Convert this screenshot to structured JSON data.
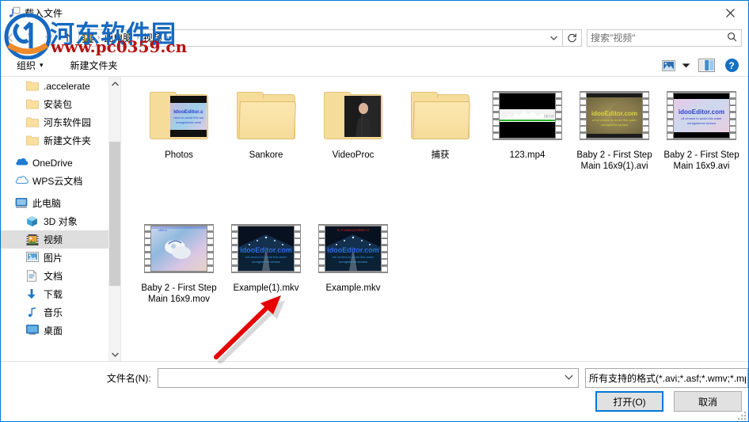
{
  "window": {
    "title": "载入文件",
    "title_icon": "music-file-icon",
    "close_label": "✕"
  },
  "nav_toolbar": {
    "back_icon": "back-arrow-icon",
    "forward_icon": "forward-arrow-icon",
    "recent_icon": "chevron-down-icon",
    "up_icon": "up-arrow-icon",
    "refresh_icon": "refresh-icon",
    "address_dropdown_icon": "chevron-down-icon",
    "breadcrumb_icon": "video-folder-icon",
    "breadcrumbs": [
      {
        "label": "此电脑"
      },
      {
        "label": "视频"
      }
    ],
    "separator": "›"
  },
  "search": {
    "placeholder": "搜索\"视频\"",
    "icon": "search-icon"
  },
  "command_bar": {
    "organize_label": "组织",
    "organize_caret": "▾",
    "new_folder_label": "新建文件夹",
    "view_icon": "view-layout-icon",
    "view_caret": "▾",
    "preview_pane_icon": "preview-pane-icon",
    "help_icon": "help-icon",
    "help_glyph": "?"
  },
  "nav_pane": {
    "items": [
      {
        "label": ".accelerate",
        "icon": "folder-icon",
        "level": 1,
        "selected": false
      },
      {
        "label": "安装包",
        "icon": "folder-icon",
        "level": 1,
        "selected": false
      },
      {
        "label": "河东软件园",
        "icon": "folder-icon",
        "level": 1,
        "selected": false
      },
      {
        "label": "新建文件夹",
        "icon": "folder-icon",
        "level": 1,
        "selected": false
      },
      {
        "label": "OneDrive",
        "icon": "onedrive-icon",
        "level": 0,
        "selected": false
      },
      {
        "label": "WPS云文档",
        "icon": "wps-cloud-icon",
        "level": 0,
        "selected": false
      },
      {
        "label": "此电脑",
        "icon": "this-pc-icon",
        "level": 0,
        "selected": false
      },
      {
        "label": "3D 对象",
        "icon": "3d-objects-icon",
        "level": 2,
        "selected": false
      },
      {
        "label": "视频",
        "icon": "videos-icon",
        "level": 2,
        "selected": true
      },
      {
        "label": "图片",
        "icon": "pictures-icon",
        "level": 2,
        "selected": false
      },
      {
        "label": "文档",
        "icon": "documents-icon",
        "level": 2,
        "selected": false
      },
      {
        "label": "下载",
        "icon": "downloads-icon",
        "level": 2,
        "selected": false
      },
      {
        "label": "音乐",
        "icon": "music-icon",
        "level": 2,
        "selected": false
      },
      {
        "label": "桌面",
        "icon": "desktop-icon",
        "level": 2,
        "selected": false
      }
    ],
    "scroll_up_glyph": "⌃",
    "scroll_down_glyph": "⌄"
  },
  "files": [
    {
      "name": "Photos",
      "type": "folder",
      "thumb": "photos-preview"
    },
    {
      "name": "Sankore",
      "type": "folder",
      "thumb": "none"
    },
    {
      "name": "VideoProc",
      "type": "folder",
      "thumb": "videoproc-preview"
    },
    {
      "name": "捕获",
      "type": "folder",
      "thumb": "none"
    },
    {
      "name": "123.mp4",
      "type": "video",
      "thumb": "waveform-dark"
    },
    {
      "name": "Baby 2 - First Step Main 16x9(1).avi",
      "type": "video",
      "thumb": "idoo-olive"
    },
    {
      "name": "Baby 2 - First Step Main 16x9.avi",
      "type": "video",
      "thumb": "idoo-pink"
    },
    {
      "name": "Baby 2 - First Step Main 16x9.mov",
      "type": "video",
      "thumb": "baby-shoes"
    },
    {
      "name": "Example(1).mkv",
      "type": "video",
      "thumb": "night-road"
    },
    {
      "name": "Example.mkv",
      "type": "video",
      "thumb": "night-road-2"
    }
  ],
  "thumb_text": {
    "idoo_main": "idooEditor.com",
    "idoo_sub1": "ull version to avoid this water",
    "idoo_sub2": "unregistered version",
    "night_top": "tc.n-www.pc0359.cn"
  },
  "footer": {
    "filename_label": "文件名(N):",
    "filename_value": "",
    "filename_dropdown_icon": "chevron-down-icon",
    "filetype_value": "所有支持的格式(*.avi;*.asf;*.wmv;*.mp",
    "open_button": "打开(O)",
    "cancel_button": "取消"
  },
  "watermark": {
    "site_name": "河东软件园",
    "site_url": "www.pc0359.cn",
    "logo": "hedong-logo"
  },
  "annotation": {
    "arrow": "red-pointer-arrow",
    "color": "#e60000",
    "points_to": "Example(1).mkv"
  },
  "colors": {
    "accent": "#0078d7",
    "selection": "#dedede",
    "folder": "#f6dc9a",
    "watermark_blue": "#1669c1",
    "watermark_red": "#b51212"
  }
}
